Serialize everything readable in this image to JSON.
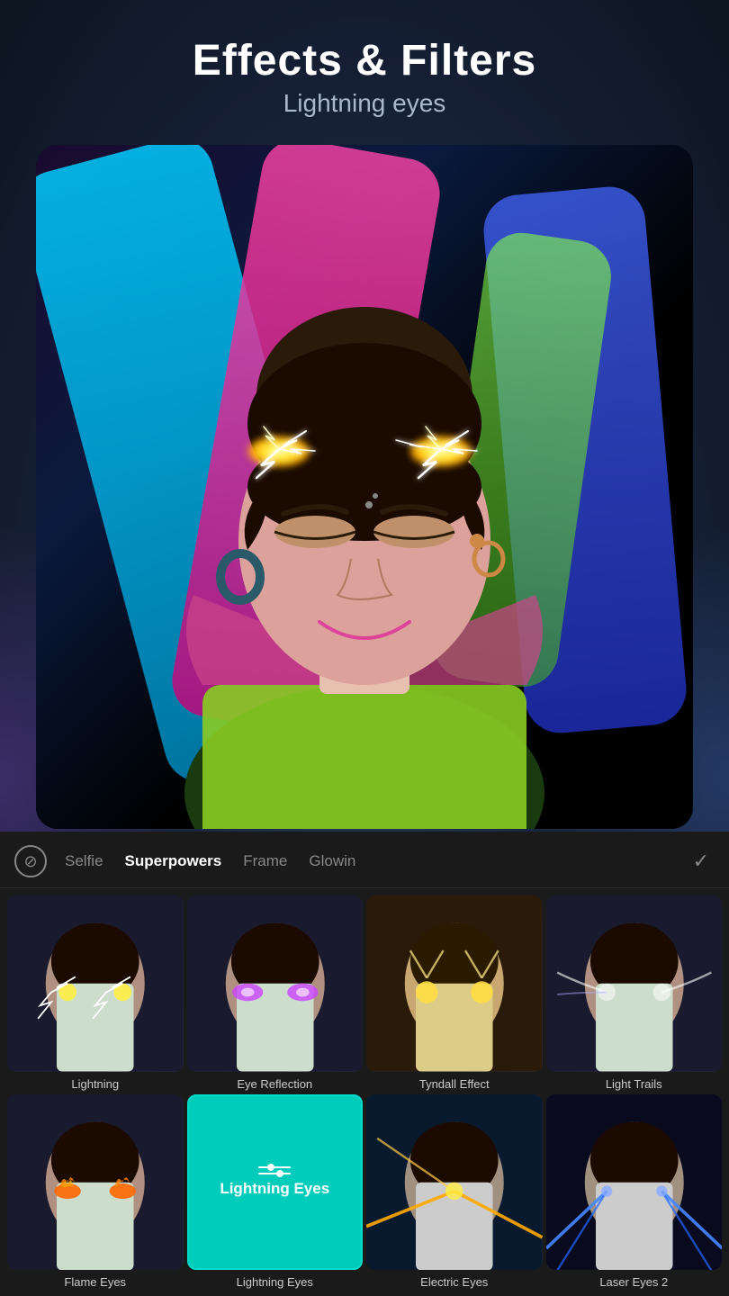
{
  "header": {
    "title": "Effects & Filters",
    "subtitle": "Lightning eyes"
  },
  "tabs": [
    {
      "id": "no-filter",
      "label": "⊘",
      "type": "icon"
    },
    {
      "id": "selfie",
      "label": "Selfie",
      "active": false
    },
    {
      "id": "superpowers",
      "label": "Superpowers",
      "active": true
    },
    {
      "id": "frame",
      "label": "Frame",
      "active": false
    },
    {
      "id": "glowin",
      "label": "Glowin",
      "active": false
    },
    {
      "id": "check",
      "label": "✓",
      "type": "icon"
    }
  ],
  "effects": [
    {
      "id": "lightning",
      "label": "Lightning",
      "type": "lightning",
      "selected": false
    },
    {
      "id": "eye-reflection",
      "label": "Eye Reflection",
      "type": "eye-reflection",
      "selected": false
    },
    {
      "id": "tyndall-effect",
      "label": "Tyndall Effect",
      "type": "tyndall",
      "selected": false
    },
    {
      "id": "light-trails",
      "label": "Light Trails",
      "type": "light-trails",
      "selected": false
    },
    {
      "id": "flame-eyes",
      "label": "Flame Eyes",
      "type": "flame-eyes",
      "selected": false
    },
    {
      "id": "lightning-eyes",
      "label": "Lightning Eyes",
      "type": "adjust",
      "selected": true
    },
    {
      "id": "electric-eyes",
      "label": "Electric Eyes",
      "type": "electric-eyes",
      "selected": false
    },
    {
      "id": "laser-eyes-2",
      "label": "Laser Eyes 2",
      "type": "laser-eyes",
      "selected": false
    }
  ],
  "colors": {
    "accent": "#00ccbb",
    "background": "#1a1a1a",
    "tab_active": "#ffffff",
    "tab_inactive": "#888888"
  }
}
